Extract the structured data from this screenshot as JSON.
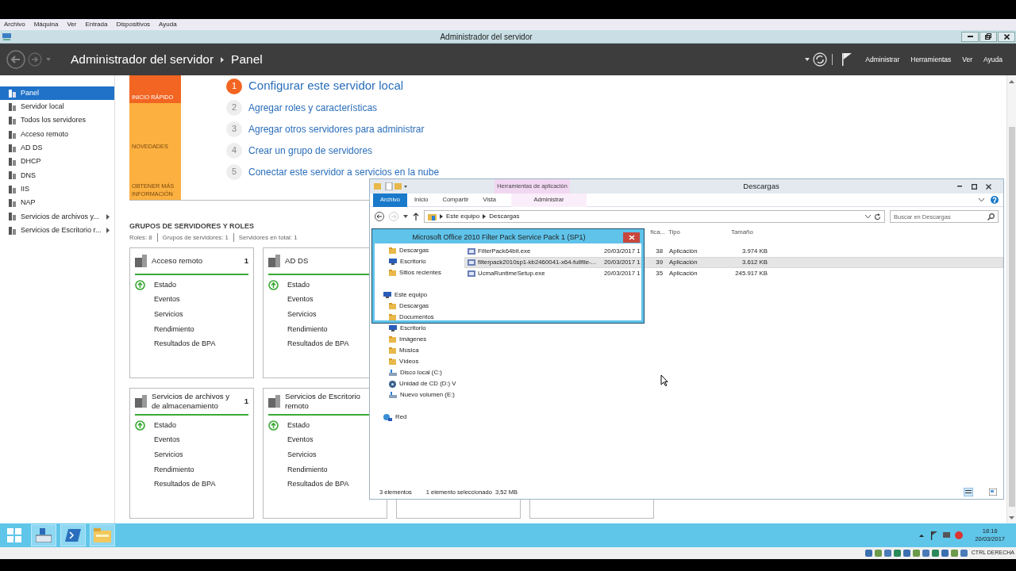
{
  "vm_menu": [
    "Archivo",
    "Máquina",
    "Ver",
    "Entrada",
    "Dispositivos",
    "Ayuda"
  ],
  "server_manager": {
    "title": "Administrador del servidor",
    "breadcrumb": [
      "Administrador del servidor",
      "Panel"
    ],
    "header_menu": [
      "Administrar",
      "Herramientas",
      "Ver",
      "Ayuda"
    ],
    "sidebar": [
      {
        "label": "Panel",
        "selected": true,
        "expandable": false
      },
      {
        "label": "Servidor local",
        "selected": false,
        "expandable": false
      },
      {
        "label": "Todos los servidores",
        "selected": false,
        "expandable": false
      },
      {
        "label": "Acceso remoto",
        "selected": false,
        "expandable": false
      },
      {
        "label": "AD DS",
        "selected": false,
        "expandable": false
      },
      {
        "label": "DHCP",
        "selected": false,
        "expandable": false
      },
      {
        "label": "DNS",
        "selected": false,
        "expandable": false
      },
      {
        "label": "IIS",
        "selected": false,
        "expandable": false
      },
      {
        "label": "NAP",
        "selected": false,
        "expandable": false
      },
      {
        "label": "Servicios de archivos y...",
        "selected": false,
        "expandable": true
      },
      {
        "label": "Servicios de Escritorio r...",
        "selected": false,
        "expandable": true
      }
    ],
    "quick_start": {
      "tiles": [
        {
          "label": "INICIO RÁPIDO",
          "color": "#f26522"
        },
        {
          "label": "NOVEDADES",
          "color": "#fbb040"
        },
        {
          "label": "OBTENER MÁS INFORMACIÓN",
          "color": "#fbb040"
        }
      ],
      "steps": [
        {
          "number": "1",
          "label": "Configurar este servidor local",
          "kind": "current"
        },
        {
          "number": "2",
          "label": "Agregar roles y características",
          "kind": "step"
        },
        {
          "number": "3",
          "label": "Agregar otros servidores para administrar",
          "kind": "step"
        },
        {
          "number": "4",
          "label": "Crear un grupo de servidores",
          "kind": "step"
        },
        {
          "number": "5",
          "label": "Conectar este servidor a servicios en la nube",
          "kind": "step"
        }
      ]
    },
    "groups": {
      "title": "GRUPOS DE SERVIDORES Y ROLES",
      "summary": [
        "Roles: 8",
        "Grupos de servidores: 1",
        "Servidores en total: 1"
      ],
      "tiles": [
        {
          "title": "Acceso remoto",
          "count": "1",
          "items": [
            "Estado",
            "Eventos",
            "Servicios",
            "Rendimiento",
            "Resultados de BPA"
          ]
        },
        {
          "title": "AD DS",
          "items": [
            "Estado",
            "Eventos",
            "Servicios",
            "Rendimiento",
            "Resultados de BPA"
          ]
        },
        {
          "title": "Servicios de archivos y de almacenamiento",
          "count": "1",
          "items": [
            "Estado",
            "Eventos",
            "Servicios",
            "Rendimiento",
            "Resultados de BPA"
          ]
        },
        {
          "title": "Servicios de Escritorio remoto",
          "items": [
            "Estado",
            "Eventos",
            "Servicios",
            "Rendimiento",
            "Resultados de BPA"
          ]
        }
      ]
    }
  },
  "explorer": {
    "title": "Descargas",
    "context_tab": "Herramientas de aplicación",
    "ribbon_tabs": [
      {
        "label": "Archivo",
        "kind": "file"
      },
      {
        "label": "Inicio",
        "kind": "tab"
      },
      {
        "label": "Compartir",
        "kind": "tab"
      },
      {
        "label": "Vista",
        "kind": "tab"
      },
      {
        "label": "Administrar",
        "kind": "context"
      }
    ],
    "path": [
      "Este equipo",
      "Descargas"
    ],
    "search": {
      "placeholder": "Buscar en Descargas"
    },
    "nav": [
      {
        "children": [
          {
            "label": "Descargas",
            "kind": "folder"
          },
          {
            "label": "Escritorio",
            "kind": "desktop"
          },
          {
            "label": "Sitios recientes",
            "kind": "recent"
          }
        ]
      },
      {
        "label": "Este equipo",
        "kind": "computer",
        "children": [
          {
            "label": "Descargas",
            "kind": "folder"
          },
          {
            "label": "Documentos",
            "kind": "folder"
          },
          {
            "label": "Escritorio",
            "kind": "desktop"
          },
          {
            "label": "Imágenes",
            "kind": "folder"
          },
          {
            "label": "Música",
            "kind": "folder"
          },
          {
            "label": "Vídeos",
            "kind": "folder"
          },
          {
            "label": "Disco local (C:)",
            "kind": "drive"
          },
          {
            "label": "Unidad de CD (D:) V",
            "kind": "disc"
          },
          {
            "label": "Nuevo volumen (E:)",
            "kind": "drive"
          }
        ]
      },
      {
        "label": "Red",
        "kind": "network"
      }
    ],
    "columns": [
      "fica...",
      "Tipo",
      "Tamaño"
    ],
    "files": [
      {
        "name": "FilterPack64bit.exe",
        "date": "20/03/2017 1",
        "date_tail": "38",
        "type": "Aplicación",
        "size": "3.974 KB",
        "selected": false
      },
      {
        "name": "filterpack2010sp1-kb2460041-x64-fullfile-...",
        "date": "20/03/2017 1",
        "date_tail": "39",
        "type": "Aplicación",
        "size": "3.612 KB",
        "selected": true
      },
      {
        "name": "UcmaRuntimeSetup.exe",
        "date": "20/03/2017 1",
        "date_tail": "35",
        "type": "Aplicación",
        "size": "245.917 KB",
        "selected": false
      }
    ],
    "status": [
      "3 elementos",
      "1 elemento seleccionado  3,52 MB"
    ]
  },
  "dialog": {
    "title": "Microsoft Office 2010 Filter Pack Service Pack 1 (SP1)"
  },
  "taskbar": {
    "time": "18:16",
    "date": "20/03/2017"
  },
  "vm_status": {
    "label": "CTRL DERECHA"
  }
}
